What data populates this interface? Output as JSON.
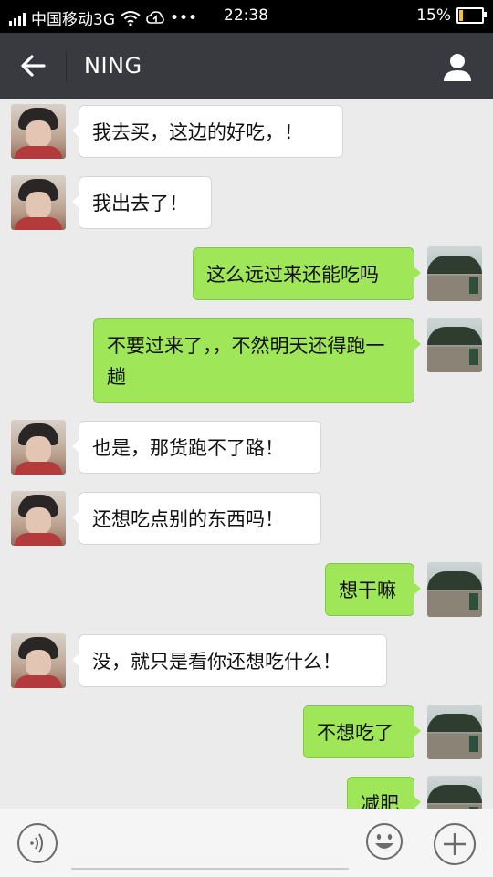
{
  "status_bar": {
    "carrier": "中国移动3G",
    "dots": "•••",
    "time": "22:38",
    "battery_percent": "15%",
    "battery_level": 0.15
  },
  "header": {
    "title": "NING",
    "back_icon": "arrow-left-icon",
    "profile_icon": "person-icon"
  },
  "messages": [
    {
      "from": "other",
      "text": "我去买，这边的好吃，！"
    },
    {
      "from": "other",
      "text": "我出去了！"
    },
    {
      "from": "me",
      "text": "这么远过来还能吃吗"
    },
    {
      "from": "me",
      "text": "不要过来了，，不然明天还得跑一趟"
    },
    {
      "from": "other",
      "text": "也是，那货跑不了路！"
    },
    {
      "from": "other",
      "text": "还想吃点别的东西吗！"
    },
    {
      "from": "me",
      "text": "想干嘛"
    },
    {
      "from": "other",
      "text": "没，就只是看你还想吃什么！"
    },
    {
      "from": "me",
      "text": "不想吃了"
    },
    {
      "from": "me",
      "text": "减肥"
    }
  ],
  "input_bar": {
    "voice_icon": "voice-icon",
    "input_value": "",
    "emoji_icon": "emoji-icon",
    "plus_icon": "plus-icon"
  },
  "colors": {
    "header_bg": "#393a3f",
    "chat_bg": "#ebebeb",
    "my_bubble": "#9fe658",
    "other_bubble": "#ffffff"
  }
}
